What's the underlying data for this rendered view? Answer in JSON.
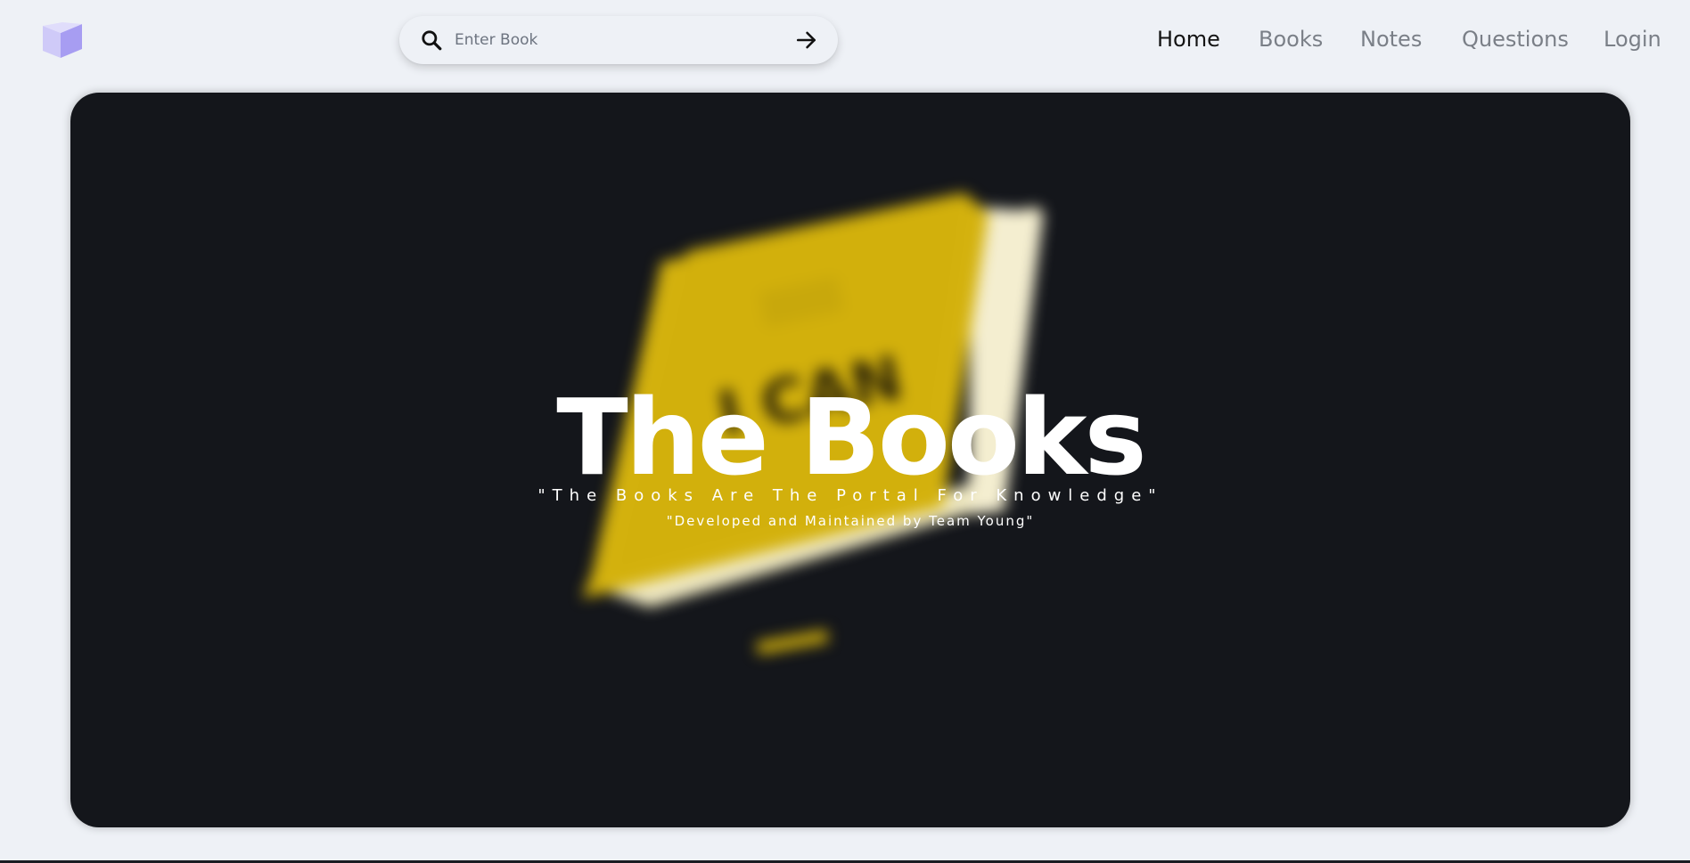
{
  "header": {
    "logo_icon": "book-logo-icon",
    "search": {
      "placeholder": "Enter Book",
      "value": "",
      "search_icon": "search-icon",
      "submit_icon": "arrow-right-icon"
    },
    "nav": [
      {
        "label": "Home",
        "active": true
      },
      {
        "label": "Books",
        "active": false
      },
      {
        "label": "Notes",
        "active": false
      },
      {
        "label": "Questions",
        "active": false
      },
      {
        "label": "Login",
        "active": false
      }
    ]
  },
  "hero": {
    "title": "The Books",
    "subtitle": "\"The Books Are The Portal For Knowledge\"",
    "credit": "\"Developed and Maintained by Team Young\"",
    "background_image": "blurred-yellow-book-image",
    "book_cover_text": "I CAN"
  },
  "colors": {
    "page_background": "#eef1f6",
    "hero_background": "#14161b",
    "book_yellow": "#d4b10d",
    "logo_purple": "#b6aef5",
    "nav_active": "#141414",
    "nav_inactive": "#7a7f87"
  }
}
